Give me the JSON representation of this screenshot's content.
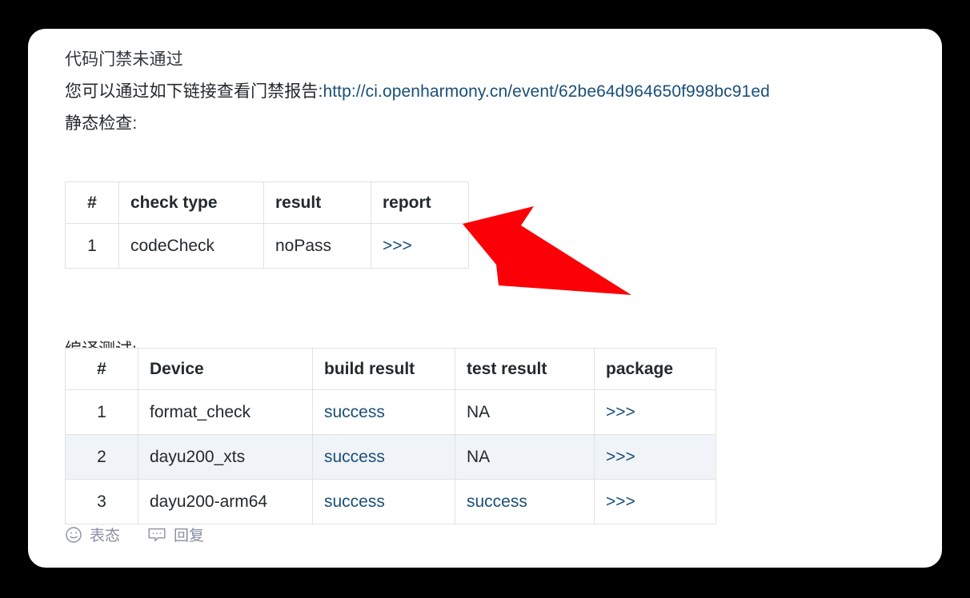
{
  "card": {
    "title": "代码门禁未通过",
    "description_prefix": "您可以通过如下链接查看门禁报告:",
    "report_url_text": "http://ci.openharmony.cn/event/62be64d964650f998bc91ed",
    "static_check_label": "静态检查:",
    "build_test_label": "编译测试:"
  },
  "static_check_table": {
    "headers": [
      "#",
      "check type",
      "result",
      "report"
    ],
    "rows": [
      {
        "index": "1",
        "check_type": "codeCheck",
        "result": "noPass",
        "report": ">>>"
      }
    ]
  },
  "build_test_table": {
    "headers": [
      "#",
      "Device",
      "build result",
      "test result",
      "package"
    ],
    "rows": [
      {
        "index": "1",
        "device": "format_check",
        "build_result": "success",
        "test_result": "NA",
        "package": ">>>"
      },
      {
        "index": "2",
        "device": "dayu200_xts",
        "build_result": "success",
        "test_result": "NA",
        "package": ">>>"
      },
      {
        "index": "3",
        "device": "dayu200-arm64",
        "build_result": "success",
        "test_result": "success",
        "package": ">>>"
      }
    ]
  },
  "actions": [
    {
      "icon": "smiley-face-icon",
      "label": "表态"
    },
    {
      "icon": "speech-bubble-icon",
      "label": "回复"
    }
  ],
  "annotation": {
    "shape": "red-arrow-pointing-up-left",
    "color": "#fb0007"
  },
  "colors": {
    "link": "#1a4f78",
    "text": "#24292e",
    "table_border": "#dfe2e5",
    "row_alt_background": "#f0f3f7",
    "card_background": "#ffffff",
    "page_background": "#000000",
    "action_text": "#8a8fa3"
  }
}
